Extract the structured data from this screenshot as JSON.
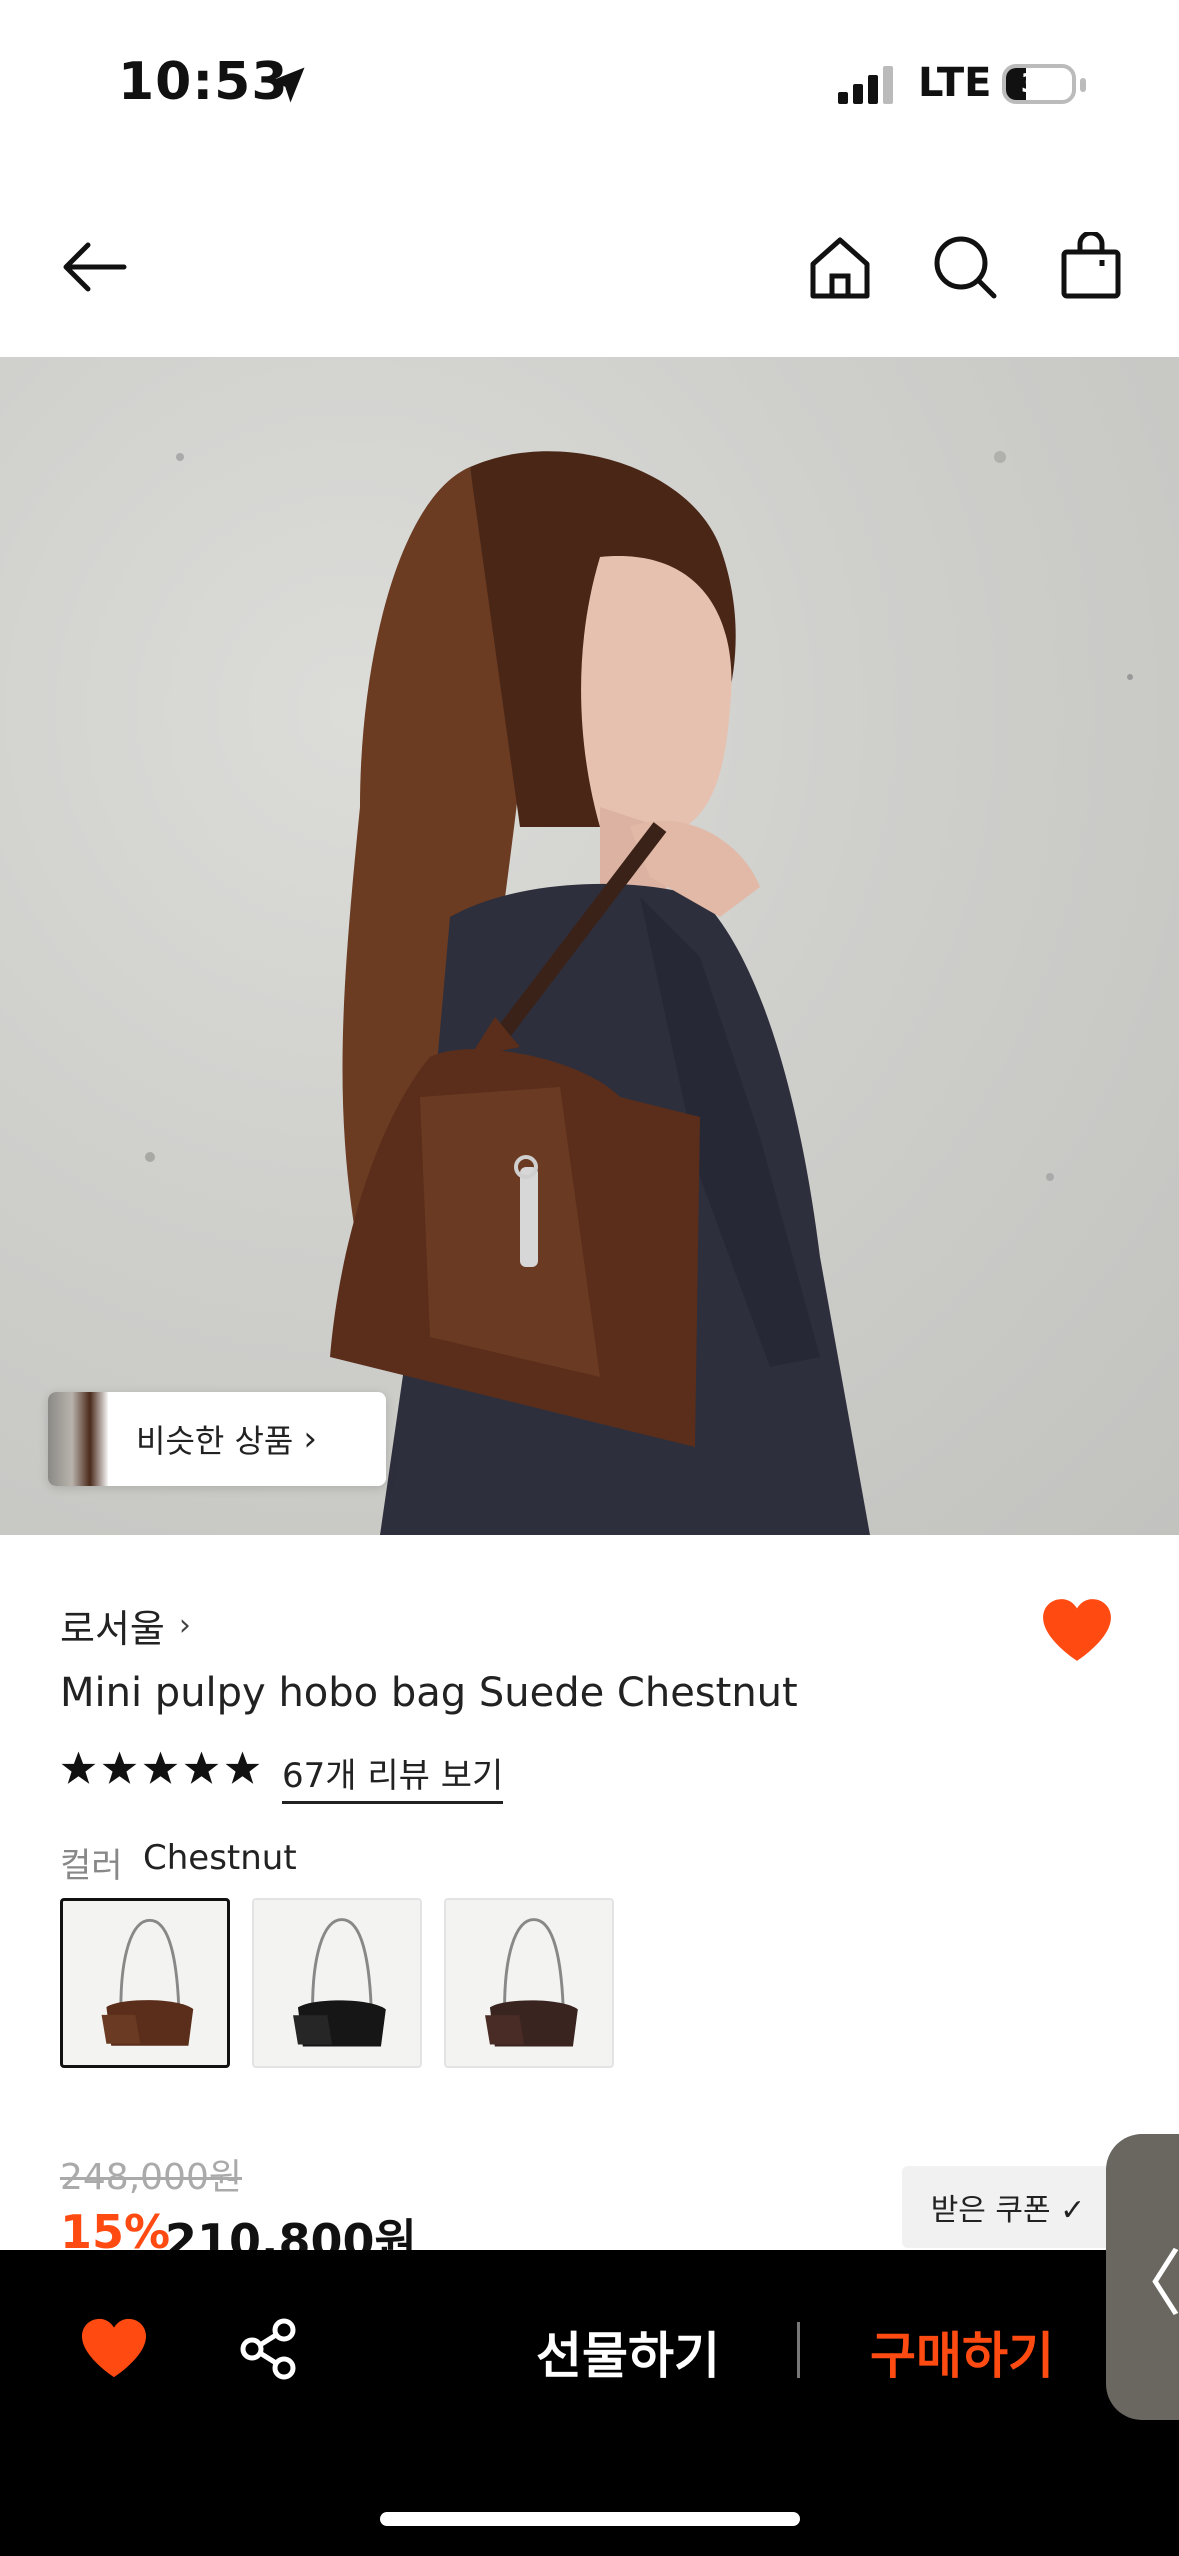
{
  "status_bar": {
    "time": "10:53",
    "network": "LTE",
    "battery": "31",
    "battery_level": 0.31
  },
  "header": {
    "back_icon": "arrow-left-icon",
    "home_icon": "home-icon",
    "search_icon": "search-icon",
    "cart_icon": "shopping-bag-icon"
  },
  "hero": {
    "similar_label": "비슷한 상품",
    "similar_chevron": "›"
  },
  "product": {
    "brand": "로서울",
    "brand_chevron": "›",
    "title": "Mini pulpy hobo bag Suede Chestnut",
    "rating": 5,
    "reviews_label": "67개 리뷰 보기",
    "color_label": "컬러",
    "color_value": "Chestnut",
    "swatches": [
      {
        "color": "Chestnut",
        "hex": "#5a2e1a",
        "selected": true
      },
      {
        "color": "Black",
        "hex": "#161616",
        "selected": false
      },
      {
        "color": "Dark Brown",
        "hex": "#3a2420",
        "selected": false
      }
    ],
    "original_price": "248,000원",
    "discount": "15%",
    "sale_price": "210,800원",
    "coupon_label": "받은 쿠폰 ✓"
  },
  "side_tab": {
    "glyph": "〈"
  },
  "bottom_bar": {
    "gift_label": "선물하기",
    "buy_label": "구매하기"
  },
  "colors": {
    "accent": "#ff4b12",
    "wishlist_heart": "#ff4b12",
    "bottom_bar_bg": "#000000"
  }
}
